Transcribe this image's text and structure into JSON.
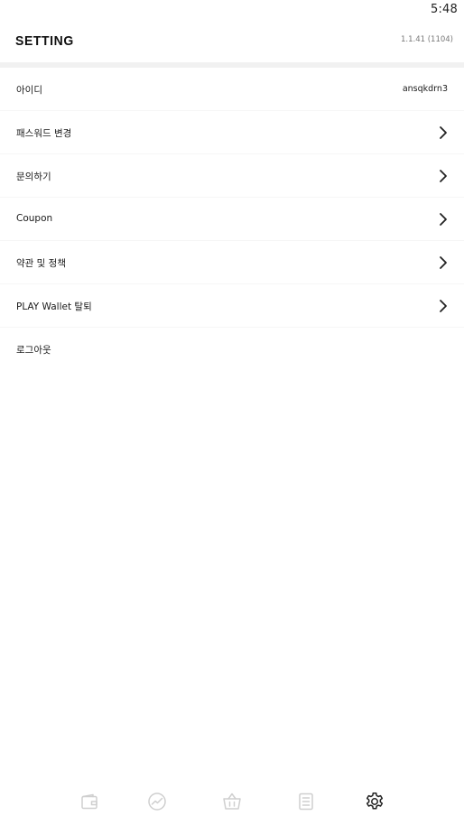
{
  "status_bar": {
    "time": "5:48"
  },
  "header": {
    "title": "SETTING",
    "version": "1.1.41 (1104)"
  },
  "menu": {
    "items": [
      {
        "label": "아이디",
        "value": "ansqkdrn3"
      },
      {
        "label": "패스워드 변경",
        "icon": "chevron-right-icon"
      },
      {
        "label": "문의하기",
        "icon": "chevron-right-icon"
      },
      {
        "label": "Coupon",
        "icon": "chevron-right-icon"
      },
      {
        "label": "약관 및 정책",
        "icon": "chevron-right-icon"
      },
      {
        "label": "PLAY Wallet 탈퇴",
        "icon": "chevron-right-icon"
      },
      {
        "label": "로그아웃"
      }
    ]
  },
  "bottom_nav": {
    "items": [
      {
        "icon": "wallet-icon"
      },
      {
        "icon": "chart-icon"
      },
      {
        "icon": "shopping-bag-icon"
      },
      {
        "icon": "document-icon"
      },
      {
        "icon": "settings-gear-icon",
        "active": true
      }
    ],
    "inactive_color": "#cfcfcf",
    "active_color": "#222222"
  }
}
